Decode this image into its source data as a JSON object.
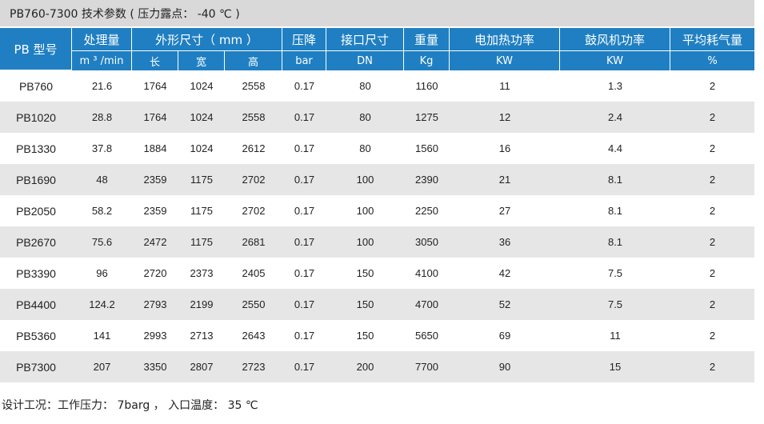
{
  "title": "PB760-7300 技术参数 ( 压力露点： -40 ℃ )",
  "header": {
    "model": "PB 型号",
    "flow": "处理量",
    "dims": "外形尺寸（ mm ）",
    "pressure_drop": "压降",
    "port": "接口尺寸",
    "weight": "重量",
    "heater": "电加热功率",
    "blower": "鼓风机功率",
    "consumption": "平均耗气量"
  },
  "units": {
    "flow": "m ³ /min",
    "length": "长",
    "width": "宽",
    "height": "高",
    "pressure_drop": "bar",
    "port": "DN",
    "weight": "Kg",
    "heater": "KW",
    "blower": "KW",
    "consumption": "%"
  },
  "rows": [
    {
      "model": "PB760",
      "flow": "21.6",
      "l": "1764",
      "w": "1024",
      "h": "2558",
      "dp": "0.17",
      "dn": "80",
      "kg": "1160",
      "heat": "11",
      "blow": "1.3",
      "cons": "2"
    },
    {
      "model": "PB1020",
      "flow": "28.8",
      "l": "1764",
      "w": "1024",
      "h": "2558",
      "dp": "0.17",
      "dn": "80",
      "kg": "1275",
      "heat": "12",
      "blow": "2.4",
      "cons": "2"
    },
    {
      "model": "PB1330",
      "flow": "37.8",
      "l": "1884",
      "w": "1024",
      "h": "2612",
      "dp": "0.17",
      "dn": "80",
      "kg": "1560",
      "heat": "16",
      "blow": "4.4",
      "cons": "2"
    },
    {
      "model": "PB1690",
      "flow": "48",
      "l": "2359",
      "w": "1175",
      "h": "2702",
      "dp": "0.17",
      "dn": "100",
      "kg": "2390",
      "heat": "21",
      "blow": "8.1",
      "cons": "2"
    },
    {
      "model": "PB2050",
      "flow": "58.2",
      "l": "2359",
      "w": "1175",
      "h": "2702",
      "dp": "0.17",
      "dn": "100",
      "kg": "2250",
      "heat": "27",
      "blow": "8.1",
      "cons": "2"
    },
    {
      "model": "PB2670",
      "flow": "75.6",
      "l": "2472",
      "w": "1175",
      "h": "2681",
      "dp": "0.17",
      "dn": "100",
      "kg": "3050",
      "heat": "36",
      "blow": "8.1",
      "cons": "2"
    },
    {
      "model": "PB3390",
      "flow": "96",
      "l": "2720",
      "w": "2373",
      "h": "2405",
      "dp": "0.17",
      "dn": "150",
      "kg": "4100",
      "heat": "42",
      "blow": "7.5",
      "cons": "2"
    },
    {
      "model": "PB4400",
      "flow": "124.2",
      "l": "2793",
      "w": "2199",
      "h": "2550",
      "dp": "0.17",
      "dn": "150",
      "kg": "4700",
      "heat": "52",
      "blow": "7.5",
      "cons": "2"
    },
    {
      "model": "PB5360",
      "flow": "141",
      "l": "2993",
      "w": "2713",
      "h": "2643",
      "dp": "0.17",
      "dn": "150",
      "kg": "5650",
      "heat": "69",
      "blow": "11",
      "cons": "2"
    },
    {
      "model": "PB7300",
      "flow": "207",
      "l": "3350",
      "w": "2807",
      "h": "2723",
      "dp": "0.17",
      "dn": "200",
      "kg": "7700",
      "heat": "90",
      "blow": "15",
      "cons": "2"
    }
  ],
  "footnote": "设计工况：工作压力： 7barg ， 入口温度： 35 ℃"
}
